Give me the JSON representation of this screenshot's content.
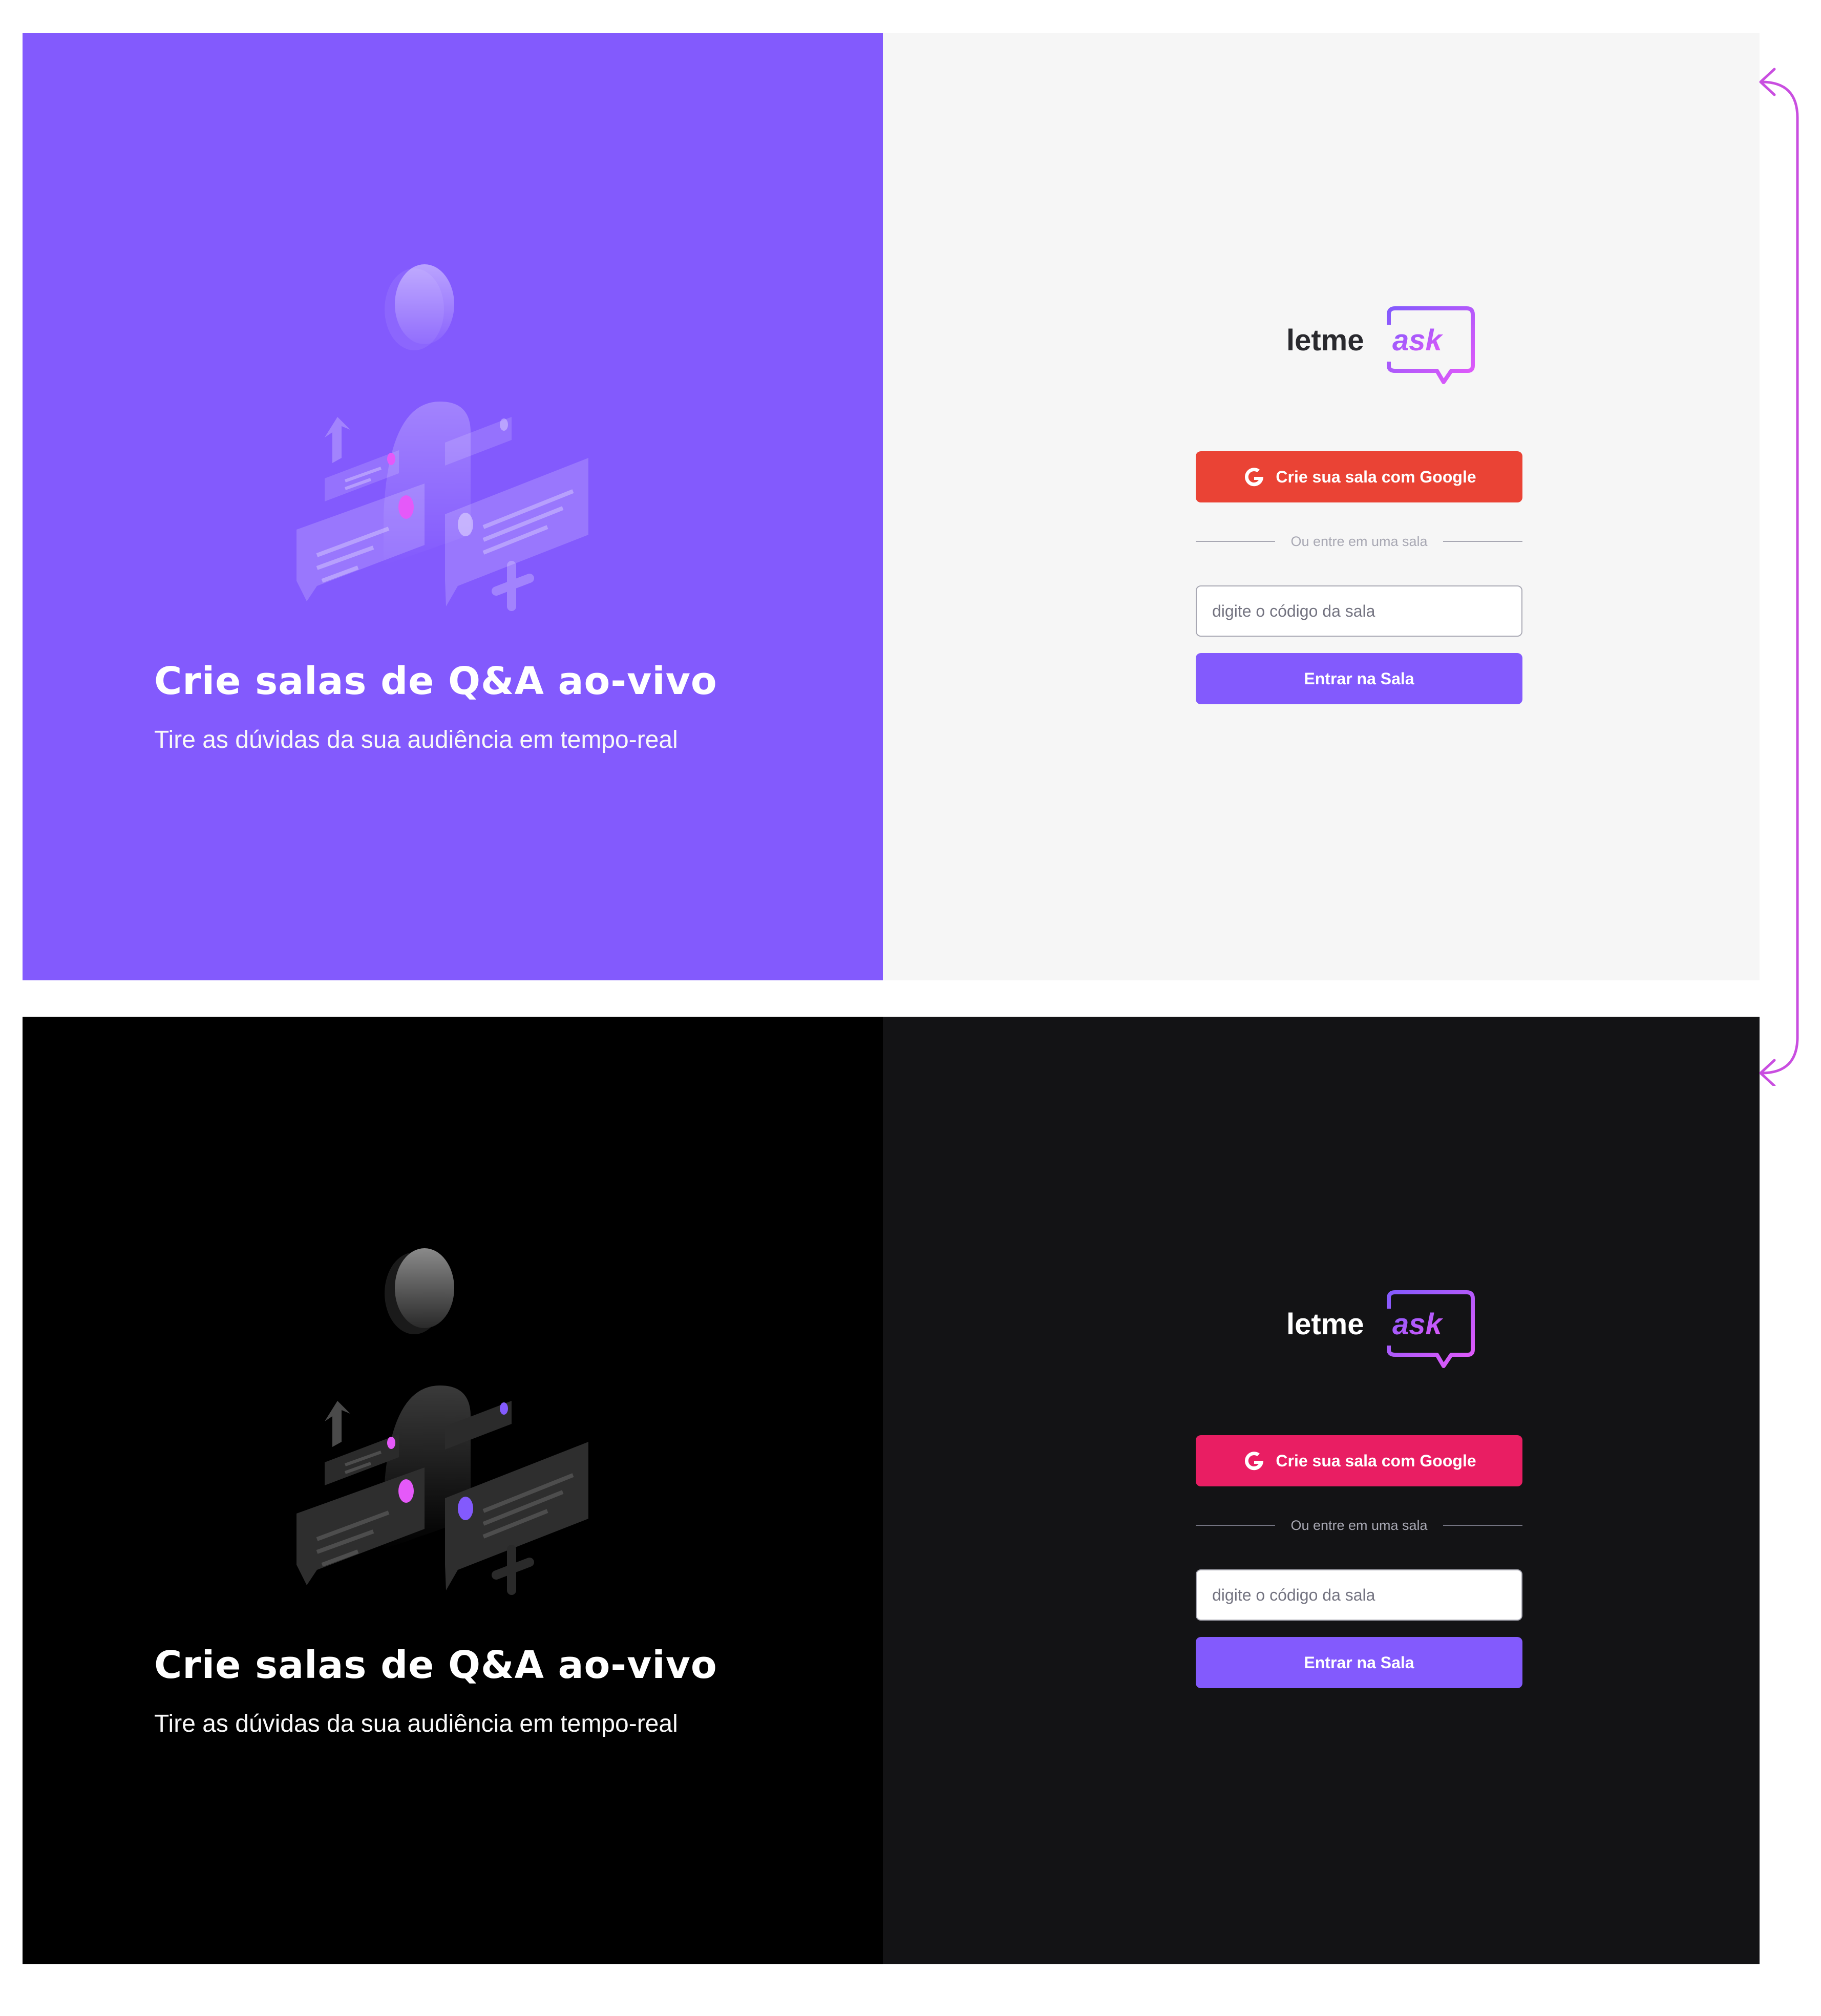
{
  "light": {
    "aside": {
      "title": "Crie salas de Q&A ao-vivo",
      "subtitle": "Tire as dúvidas da sua audiência em tempo-real"
    },
    "main": {
      "logo_text_1": "letme",
      "logo_text_2": "ask",
      "google_button": "Crie sua sala com Google",
      "separator": "Ou entre em uma sala",
      "room_input_placeholder": "digite o código da sala",
      "enter_button": "Entrar na Sala"
    }
  },
  "dark": {
    "aside": {
      "title": "Crie salas de Q&A ao-vivo",
      "subtitle": "Tire as dúvidas da sua audiência em tempo-real"
    },
    "main": {
      "logo_text_1": "letme",
      "logo_text_2": "ask",
      "google_button": "Crie sua sala com Google",
      "separator": "Ou entre em uma sala",
      "room_input_placeholder": "digite o código da sala",
      "enter_button": "Entrar na Sala"
    }
  },
  "colors": {
    "brand_purple": "#835afd",
    "google_light": "#ea4335",
    "google_dark": "#e91e63",
    "accent_pink": "#e559f9",
    "connector": "#c94ee0"
  },
  "icons": [
    "person-illustration",
    "google-icon",
    "logo-bubble-icon",
    "swap-arrows-icon"
  ]
}
